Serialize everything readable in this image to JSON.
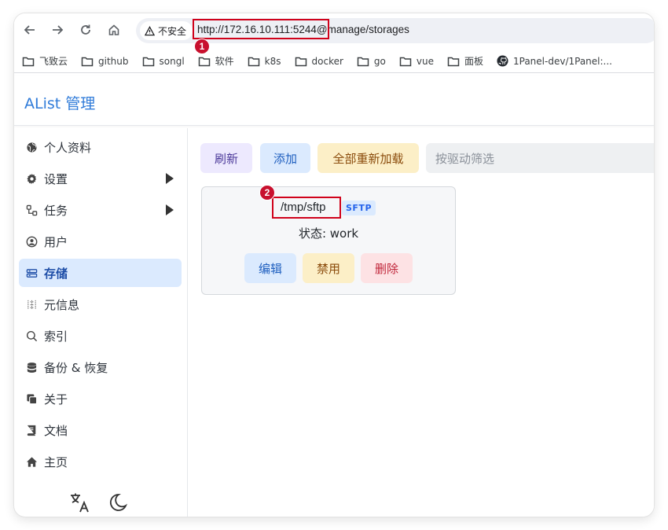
{
  "browser": {
    "security_label": "不安全",
    "url_host": "http://172.16.10.111:5244",
    "url_path": "@manage/storages",
    "bookmarks": [
      "飞致云",
      "github",
      "songl",
      "软件",
      "k8s",
      "docker",
      "go",
      "vue",
      "面板",
      "1Panel-dev/1Panel:..."
    ]
  },
  "annotations": [
    "1",
    "2"
  ],
  "app": {
    "title": "AList 管理"
  },
  "sidebar": {
    "items": [
      {
        "label": "个人资料",
        "icon": "globe-icon"
      },
      {
        "label": "设置",
        "icon": "gear-icon",
        "expandable": true
      },
      {
        "label": "任务",
        "icon": "tasks-icon",
        "expandable": true
      },
      {
        "label": "用户",
        "icon": "user-circle-icon"
      },
      {
        "label": "存储",
        "icon": "storage-icon",
        "active": true
      },
      {
        "label": "元信息",
        "icon": "meta-icon"
      },
      {
        "label": "索引",
        "icon": "search-icon"
      },
      {
        "label": "备份 & 恢复",
        "icon": "database-icon"
      },
      {
        "label": "关于",
        "icon": "about-icon"
      },
      {
        "label": "文档",
        "icon": "book-icon"
      },
      {
        "label": "主页",
        "icon": "home-icon"
      }
    ]
  },
  "toolbar": {
    "refresh": "刷新",
    "add": "添加",
    "reload_all": "全部重新加载",
    "filter_placeholder": "按驱动筛选"
  },
  "storage_card": {
    "mount_path": "/tmp/sftp",
    "driver": "SFTP",
    "status": "状态: work",
    "edit": "编辑",
    "disable": "禁用",
    "delete": "删除"
  },
  "colors": {
    "accent": "#2f7bd9",
    "active_bg": "#dbeafe",
    "annotation_red": "#d0021b"
  }
}
